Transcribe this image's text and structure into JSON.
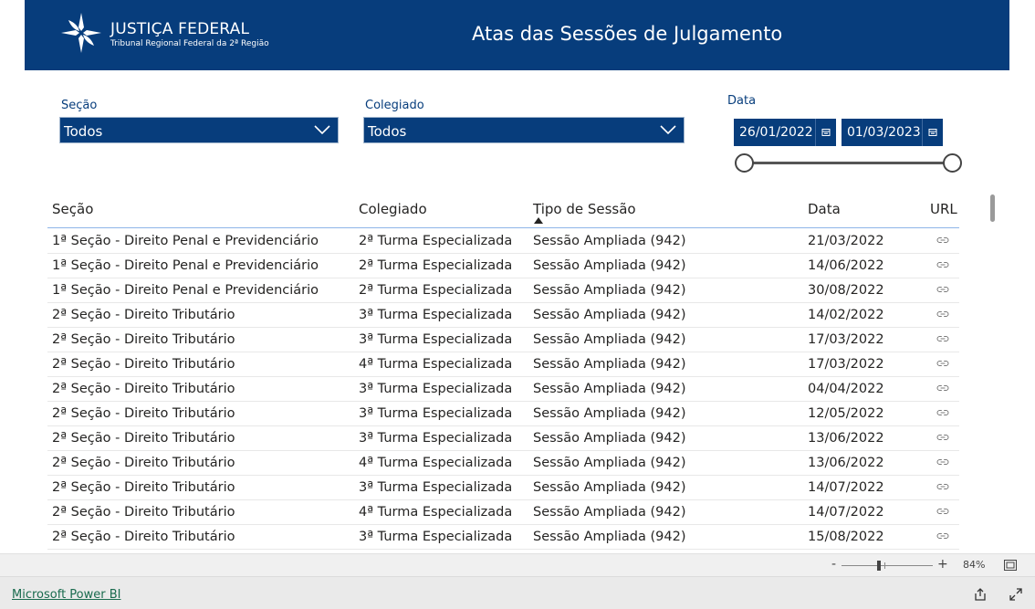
{
  "header": {
    "logo_title": "JUSTIÇA FEDERAL",
    "logo_subtitle": "Tribunal Regional Federal da 2ª Região",
    "page_title": "Atas das Sessões de Julgamento",
    "bg_color": "#073d7c"
  },
  "filters": {
    "secao": {
      "label": "Seção",
      "value": "Todos"
    },
    "colegiado": {
      "label": "Colegiado",
      "value": "Todos"
    },
    "data": {
      "label": "Data",
      "start": "26/01/2022",
      "end": "01/03/2023"
    }
  },
  "table": {
    "columns": [
      "Seção",
      "Colegiado",
      "Tipo de Sessão",
      "Data",
      "URL"
    ],
    "sort_column": "Tipo de Sessão",
    "sort_direction": "ascending",
    "rows": [
      {
        "secao": "1ª Seção - Direito Penal e Previdenciário",
        "colegiado": "2ª Turma Especializada",
        "tipo": "Sessão Ampliada (942)",
        "data": "21/03/2022"
      },
      {
        "secao": "1ª Seção - Direito Penal e Previdenciário",
        "colegiado": "2ª Turma Especializada",
        "tipo": "Sessão Ampliada (942)",
        "data": "14/06/2022"
      },
      {
        "secao": "1ª Seção - Direito Penal e Previdenciário",
        "colegiado": "2ª Turma Especializada",
        "tipo": "Sessão Ampliada (942)",
        "data": "30/08/2022"
      },
      {
        "secao": "2ª Seção - Direito Tributário",
        "colegiado": "3ª Turma Especializada",
        "tipo": "Sessão Ampliada (942)",
        "data": "14/02/2022"
      },
      {
        "secao": "2ª Seção - Direito Tributário",
        "colegiado": "3ª Turma Especializada",
        "tipo": "Sessão Ampliada (942)",
        "data": "17/03/2022"
      },
      {
        "secao": "2ª Seção - Direito Tributário",
        "colegiado": "4ª Turma Especializada",
        "tipo": "Sessão Ampliada (942)",
        "data": "17/03/2022"
      },
      {
        "secao": "2ª Seção - Direito Tributário",
        "colegiado": "3ª Turma Especializada",
        "tipo": "Sessão Ampliada (942)",
        "data": "04/04/2022"
      },
      {
        "secao": "2ª Seção - Direito Tributário",
        "colegiado": "3ª Turma Especializada",
        "tipo": "Sessão Ampliada (942)",
        "data": "12/05/2022"
      },
      {
        "secao": "2ª Seção - Direito Tributário",
        "colegiado": "3ª Turma Especializada",
        "tipo": "Sessão Ampliada (942)",
        "data": "13/06/2022"
      },
      {
        "secao": "2ª Seção - Direito Tributário",
        "colegiado": "4ª Turma Especializada",
        "tipo": "Sessão Ampliada (942)",
        "data": "13/06/2022"
      },
      {
        "secao": "2ª Seção - Direito Tributário",
        "colegiado": "3ª Turma Especializada",
        "tipo": "Sessão Ampliada (942)",
        "data": "14/07/2022"
      },
      {
        "secao": "2ª Seção - Direito Tributário",
        "colegiado": "4ª Turma Especializada",
        "tipo": "Sessão Ampliada (942)",
        "data": "14/07/2022"
      },
      {
        "secao": "2ª Seção - Direito Tributário",
        "colegiado": "3ª Turma Especializada",
        "tipo": "Sessão Ampliada (942)",
        "data": "15/08/2022"
      }
    ]
  },
  "zoom": {
    "minus": "-",
    "plus": "+",
    "value": "84%"
  },
  "footer": {
    "link_label": "Microsoft Power BI"
  },
  "icons": {
    "dropdown": "chevron-down-icon",
    "date": "calendar-icon",
    "url": "link-icon",
    "sort": "sort-ascending-icon",
    "fit": "fit-to-page-icon",
    "share": "share-icon",
    "expand": "expand-icon"
  }
}
